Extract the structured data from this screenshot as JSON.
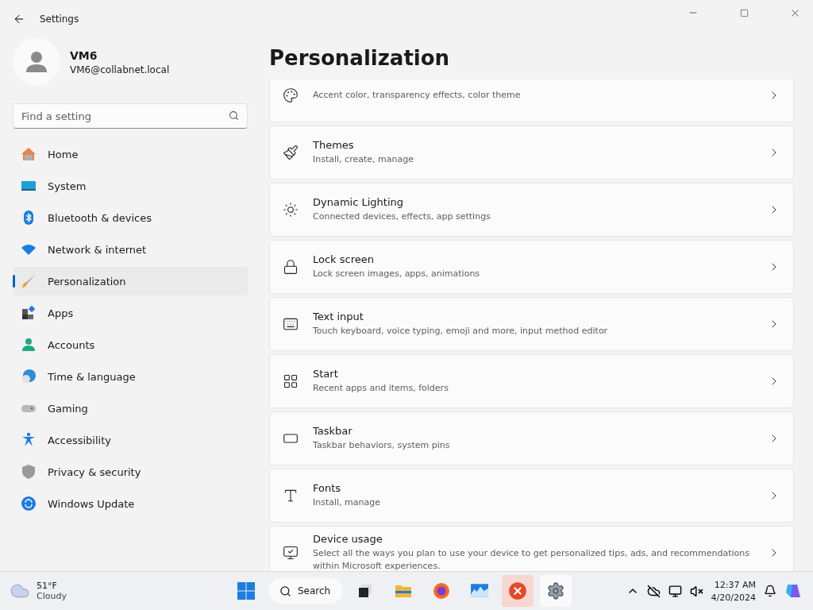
{
  "window": {
    "title": "Settings"
  },
  "user": {
    "name": "VM6",
    "email": "VM6@collabnet.local"
  },
  "search": {
    "placeholder": "Find a setting"
  },
  "nav": [
    {
      "label": "Home",
      "selected": false
    },
    {
      "label": "System",
      "selected": false
    },
    {
      "label": "Bluetooth & devices",
      "selected": false
    },
    {
      "label": "Network & internet",
      "selected": false
    },
    {
      "label": "Personalization",
      "selected": true
    },
    {
      "label": "Apps",
      "selected": false
    },
    {
      "label": "Accounts",
      "selected": false
    },
    {
      "label": "Time & language",
      "selected": false
    },
    {
      "label": "Gaming",
      "selected": false
    },
    {
      "label": "Accessibility",
      "selected": false
    },
    {
      "label": "Privacy & security",
      "selected": false
    },
    {
      "label": "Windows Update",
      "selected": false
    }
  ],
  "page": {
    "title": "Personalization"
  },
  "cards": [
    {
      "subtitle": "Accent color, transparency effects, color theme"
    },
    {
      "title": "Themes",
      "subtitle": "Install, create, manage"
    },
    {
      "title": "Dynamic Lighting",
      "subtitle": "Connected devices, effects, app settings"
    },
    {
      "title": "Lock screen",
      "subtitle": "Lock screen images, apps, animations"
    },
    {
      "title": "Text input",
      "subtitle": "Touch keyboard, voice typing, emoji and more, input method editor"
    },
    {
      "title": "Start",
      "subtitle": "Recent apps and items, folders"
    },
    {
      "title": "Taskbar",
      "subtitle": "Taskbar behaviors, system pins"
    },
    {
      "title": "Fonts",
      "subtitle": "Install, manage"
    },
    {
      "title": "Device usage",
      "subtitle": "Select all the ways you plan to use your device to get personalized tips, ads, and recommendations within Microsoft experiences."
    }
  ],
  "taskbar": {
    "weather": {
      "temp": "51°F",
      "condition": "Cloudy"
    },
    "search": "Search",
    "time": "12:37 AM",
    "date": "4/20/2024"
  }
}
